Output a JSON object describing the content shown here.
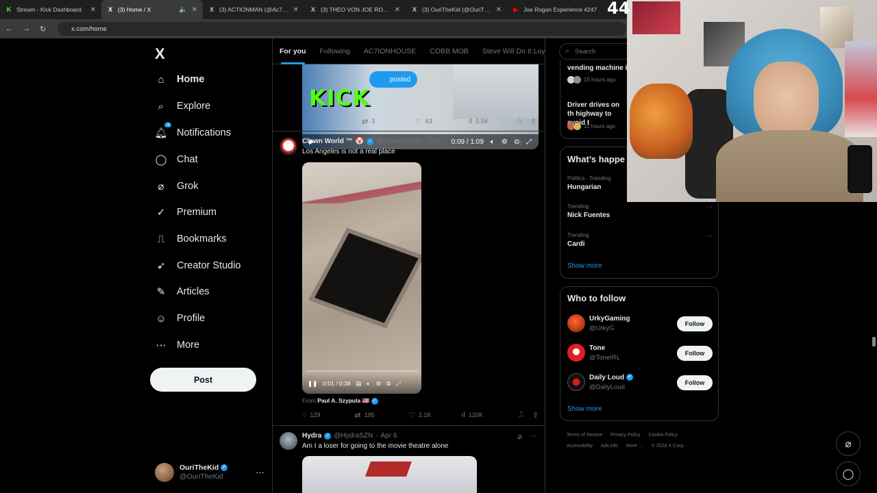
{
  "browser": {
    "tabs": [
      {
        "title": "Stream - Kick Dashboard",
        "favicon": "K",
        "favicon_color": "#53fc18"
      },
      {
        "title": "(3) Home / X",
        "favicon": "X",
        "favicon_color": "#ffffff"
      },
      {
        "title": "(3) ACTIONMAN (@Ac7ionM",
        "favicon": "X",
        "favicon_color": "#ffffff"
      },
      {
        "title": "(3) THEO VON JOE ROGAN",
        "favicon": "X",
        "favicon_color": "#ffffff"
      },
      {
        "title": "(3) OuriTheKid (@OuriTheKi",
        "favicon": "X",
        "favicon_color": "#ffffff"
      },
      {
        "title": "Joe Rogan Experience #247",
        "favicon": "▶",
        "favicon_color": "#ff0000"
      }
    ],
    "url": "x.com/home",
    "counter_overlay": "44"
  },
  "nav": {
    "logo": "X",
    "items": [
      {
        "label": "Home",
        "icon": "home-icon",
        "glyph": "⌂"
      },
      {
        "label": "Explore",
        "icon": "search-icon",
        "glyph": "⌕"
      },
      {
        "label": "Notifications",
        "icon": "bell-icon",
        "glyph": "♫",
        "badge": "3"
      },
      {
        "label": "Chat",
        "icon": "chat-icon",
        "glyph": "◯"
      },
      {
        "label": "Grok",
        "icon": "grok-icon",
        "glyph": "⌀"
      },
      {
        "label": "Premium",
        "icon": "premium-icon",
        "glyph": "✓"
      },
      {
        "label": "Bookmarks",
        "icon": "bookmark-icon",
        "glyph": "⎍"
      },
      {
        "label": "Creator Studio",
        "icon": "rocket-icon",
        "glyph": "➶"
      },
      {
        "label": "Articles",
        "icon": "articles-icon",
        "glyph": "✎"
      },
      {
        "label": "Profile",
        "icon": "profile-icon",
        "glyph": "☺"
      },
      {
        "label": "More",
        "icon": "more-icon",
        "glyph": "⋯"
      }
    ],
    "post_label": "Post",
    "account": {
      "name": "OuriTheKid",
      "handle": "@OuriTheKid"
    }
  },
  "timeline": {
    "tabs": [
      "For you",
      "Following",
      "AC7IONHOUSE",
      "COBB MOB",
      "Steve Will Do It Loyal"
    ],
    "video_top": {
      "banner_text": "KICK",
      "posted_label": "posted",
      "time": "0:09 / 1:09",
      "stats": {
        "replies": "6",
        "reposts": "3",
        "likes": "63",
        "views": "5.5K"
      }
    },
    "tweet1": {
      "name": "Clown World ™",
      "handle": "@ClownWorld",
      "time": "22h",
      "text": "Los Angeles is not a real place",
      "video_time": "0:01 / 0:38",
      "from_prefix": "From",
      "from_name": "Paul A. Szypula 🇺🇸",
      "stats": {
        "replies": "129",
        "reposts": "195",
        "likes": "2.1K",
        "views": "120K"
      }
    },
    "tweet2": {
      "name": "Hydra",
      "handle": "@HydraSZN",
      "time": "Apr 6",
      "text": "Am I a loser for going to the movie theatre alone"
    }
  },
  "sidebar": {
    "search_placeholder": "Search",
    "news": [
      {
        "title": "vending machine i",
        "meta": "15 hours ago"
      },
      {
        "title": "Driver drives on th highway to avoid t",
        "meta": "11 hours ago"
      }
    ],
    "trending_title": "What’s happe",
    "trends": [
      {
        "category": "Politics · Trending",
        "name": "Hungarian"
      },
      {
        "category": "Trending",
        "name": "Nick Fuentes"
      },
      {
        "category": "Trending",
        "name": "Cardi"
      }
    ],
    "show_more": "Show more",
    "who_to_follow_title": "Who to follow",
    "follow_suggestions": [
      {
        "name": "UrkyGaming",
        "handle": "@UrkyG",
        "button": "Follow"
      },
      {
        "name": "Tone",
        "handle": "@ToneIRL",
        "button": "Follow"
      },
      {
        "name": "Daily Loud",
        "handle": "@DailyLoud",
        "button": "Follow"
      }
    ],
    "footer_links": [
      "Terms of Service",
      "Privacy Policy",
      "Cookie Policy",
      "Accessibility",
      "Ads info",
      "More ···",
      "© 2026 X Corp."
    ]
  }
}
